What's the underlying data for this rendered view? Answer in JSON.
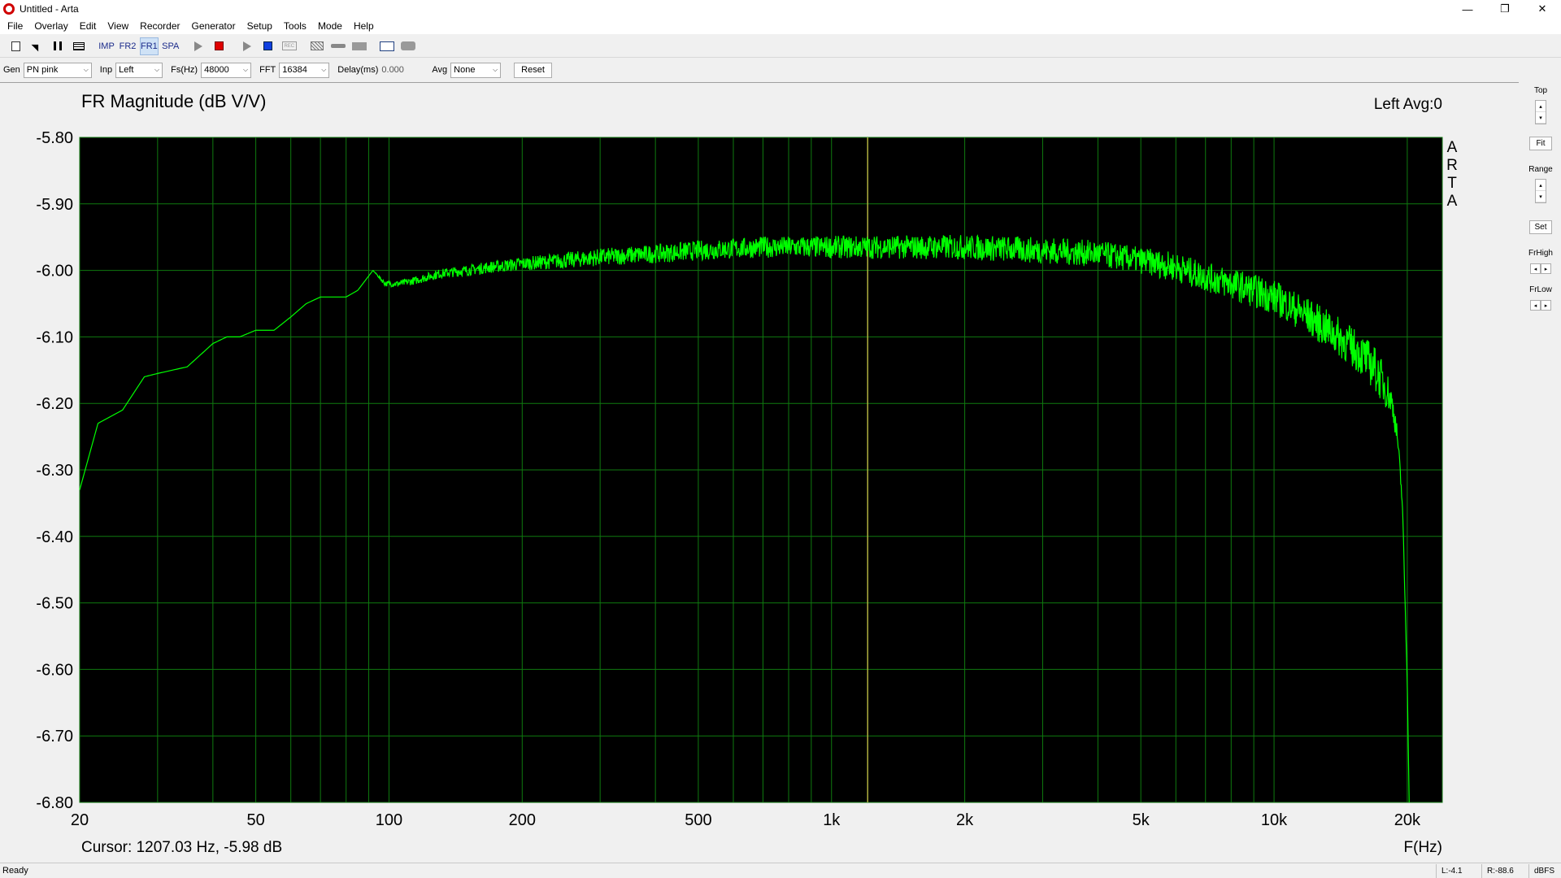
{
  "window": {
    "title": "Untitled - Arta",
    "minimize": "—",
    "maximize": "❐",
    "close": "✕"
  },
  "menu": [
    "File",
    "Overlay",
    "Edit",
    "View",
    "Recorder",
    "Generator",
    "Setup",
    "Tools",
    "Mode",
    "Help"
  ],
  "toolbar": {
    "icons": {
      "new": "new-document-icon",
      "open": "open-icon",
      "pause": "pause-icon",
      "grid": "table-icon",
      "play_gen": "play-icon",
      "stop_red": "stop-red-icon",
      "play_rec": "play-icon",
      "stop_blue": "stop-blue-icon",
      "rec": "record-icon",
      "hatch": "hatch-icon",
      "slider": "slider-icon",
      "bar": "bar-icon",
      "scope": "scope-icon",
      "pill": "pill-icon"
    },
    "modes": [
      "IMP",
      "FR2",
      "FR1",
      "SPA"
    ],
    "active_mode": "FR1",
    "rec_text": "REC"
  },
  "settings": {
    "gen_label": "Gen",
    "gen_value": "PN pink",
    "inp_label": "Inp",
    "inp_value": "Left",
    "fs_label": "Fs(Hz)",
    "fs_value": "48000",
    "fft_label": "FFT",
    "fft_value": "16384",
    "delay_label": "Delay(ms)",
    "delay_value": "0.000",
    "avg_label": "Avg",
    "avg_value": "None",
    "reset_label": "Reset",
    "arrow": "⌵"
  },
  "side": {
    "top_label": "Top",
    "fit_label": "Fit",
    "range_label": "Range",
    "set_label": "Set",
    "frhigh_label": "FrHigh",
    "frlow_label": "FrLow",
    "up": "▴",
    "down": "▾",
    "left": "◂",
    "right": "▸"
  },
  "plot": {
    "title": "FR Magnitude (dB V/V)",
    "channel_info": "Left  Avg:0",
    "watermark": [
      "A",
      "R",
      "T",
      "A"
    ],
    "cursor_text": "Cursor: 1207.03 Hz, -5.98 dB",
    "x_unit": "F(Hz)",
    "background": "#000000",
    "grid_color": "#0f7a0f",
    "trace_color": "#00ff00",
    "cursor_color": "#b0b040"
  },
  "chart_data": {
    "type": "line",
    "title": "FR Magnitude (dB V/V)",
    "xlabel": "F(Hz)",
    "ylabel": "",
    "x_scale": "log",
    "xlim": [
      20,
      24000
    ],
    "ylim": [
      -6.8,
      -5.8
    ],
    "y_ticks": [
      "-5.80",
      "-5.90",
      "-6.00",
      "-6.10",
      "-6.20",
      "-6.30",
      "-6.40",
      "-6.50",
      "-6.60",
      "-6.70",
      "-6.80"
    ],
    "x_ticks": [
      {
        "value": 20,
        "label": "20"
      },
      {
        "value": 50,
        "label": "50"
      },
      {
        "value": 100,
        "label": "100"
      },
      {
        "value": 200,
        "label": "200"
      },
      {
        "value": 500,
        "label": "500"
      },
      {
        "value": 1000,
        "label": "1k"
      },
      {
        "value": 2000,
        "label": "2k"
      },
      {
        "value": 5000,
        "label": "5k"
      },
      {
        "value": 10000,
        "label": "10k"
      },
      {
        "value": 20000,
        "label": "20k"
      }
    ],
    "cursor_x": 1207.03,
    "series": [
      {
        "color": "#00ff00",
        "x": [
          20,
          22,
          25,
          28,
          30,
          35,
          40,
          43,
          46,
          50,
          55,
          60,
          65,
          70,
          75,
          80,
          85,
          92,
          98,
          105,
          115,
          130,
          150,
          170,
          200,
          250,
          300,
          400,
          500,
          700,
          1000,
          1500,
          2000,
          3000,
          4000,
          5000,
          6000,
          7000,
          8000,
          10000,
          12000,
          14000,
          16000,
          17000,
          18000,
          18500,
          19000,
          19500,
          20000,
          20200
        ],
        "y": [
          -6.33,
          -6.23,
          -6.21,
          -6.16,
          -6.155,
          -6.145,
          -6.11,
          -6.1,
          -6.1,
          -6.09,
          -6.09,
          -6.07,
          -6.05,
          -6.04,
          -6.04,
          -6.04,
          -6.03,
          -6.0,
          -6.02,
          -6.02,
          -6.015,
          -6.005,
          -6.0,
          -5.995,
          -5.99,
          -5.985,
          -5.98,
          -5.975,
          -5.97,
          -5.965,
          -5.965,
          -5.965,
          -5.965,
          -5.97,
          -5.975,
          -5.985,
          -5.995,
          -6.01,
          -6.02,
          -6.04,
          -6.07,
          -6.1,
          -6.13,
          -6.15,
          -6.18,
          -6.2,
          -6.25,
          -6.35,
          -6.62,
          -6.8
        ],
        "noise": [
          0,
          0,
          0,
          0,
          0,
          0,
          0,
          0,
          0,
          0,
          0,
          0,
          0,
          0,
          0,
          0,
          0,
          0,
          0.004,
          0.005,
          0.006,
          0.007,
          0.008,
          0.009,
          0.01,
          0.012,
          0.013,
          0.014,
          0.015,
          0.016,
          0.017,
          0.018,
          0.019,
          0.02,
          0.02,
          0.02,
          0.022,
          0.022,
          0.024,
          0.026,
          0.028,
          0.03,
          0.032,
          0.034,
          0.03,
          0.02,
          0.015,
          0.01,
          0,
          0
        ]
      }
    ]
  }
}
